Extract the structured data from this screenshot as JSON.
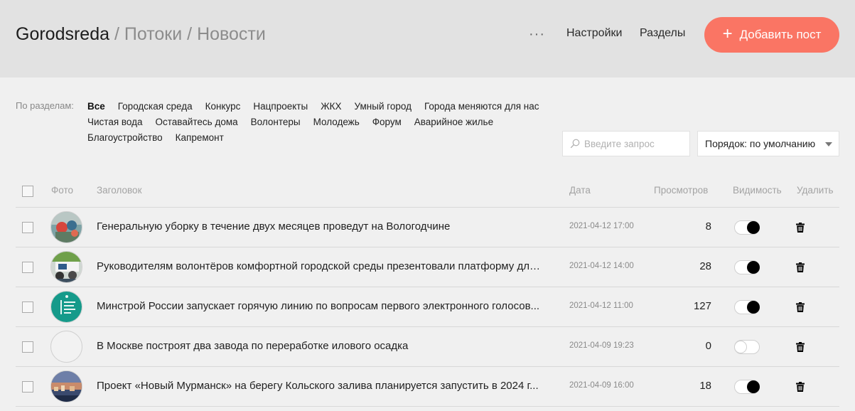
{
  "header": {
    "brand": "Gorodsreda",
    "crumb_sep": "/",
    "crumb_1": "Потоки",
    "crumb_2": "Новости",
    "more_label": "···",
    "nav_settings": "Настройки",
    "nav_sections": "Разделы",
    "add_plus": "+",
    "add_label": "Добавить пост",
    "accent": "#fa7564"
  },
  "filters": {
    "label": "По разделам:",
    "rows": [
      [
        "Все",
        "Городская среда",
        "Конкурс",
        "Нацпроекты",
        "ЖКХ",
        "Умный город",
        "Города меняются для нас"
      ],
      [
        "Чистая вода",
        "Оставайтесь дома",
        "Волонтеры",
        "Молодежь",
        "Форум",
        "Аварийное жилье"
      ],
      [
        "Благоустройство",
        "Капремонт"
      ]
    ],
    "active": "Все"
  },
  "search": {
    "placeholder": "Введите запрос",
    "icon": "search-icon"
  },
  "order": {
    "label": "Порядок: по умолчанию"
  },
  "table": {
    "columns": {
      "photo": "Фото",
      "title": "Заголовок",
      "date": "Дата",
      "views": "Просмотров",
      "visibility": "Видимость",
      "delete": "Удалить"
    },
    "rows": [
      {
        "title": "Генеральную уборку в течение двух месяцев проведут на Вологодчине",
        "date": "2021-04-12 17:00",
        "views": "8",
        "visible": true,
        "photo": "thumb-cleanup"
      },
      {
        "title": "Руководителям волонтёров комфортной городской среды презентовали платформу для г...",
        "date": "2021-04-12 14:00",
        "views": "28",
        "visible": true,
        "photo": "thumb-volunteers"
      },
      {
        "title": "Минстрой России запускает горячую линию по вопросам первого электронного голосов...",
        "date": "2021-04-12 11:00",
        "views": "127",
        "visible": true,
        "photo": "thumb-minstroy"
      },
      {
        "title": "В Москве построят два завода по переработке илового осадка",
        "date": "2021-04-09 19:23",
        "views": "0",
        "visible": false,
        "photo": "thumb-empty"
      },
      {
        "title": "Проект «Новый Мурманск» на берегу Кольского залива планируется запустить в 2024 г...",
        "date": "2021-04-09 16:00",
        "views": "18",
        "visible": true,
        "photo": "thumb-murmansk"
      }
    ]
  }
}
